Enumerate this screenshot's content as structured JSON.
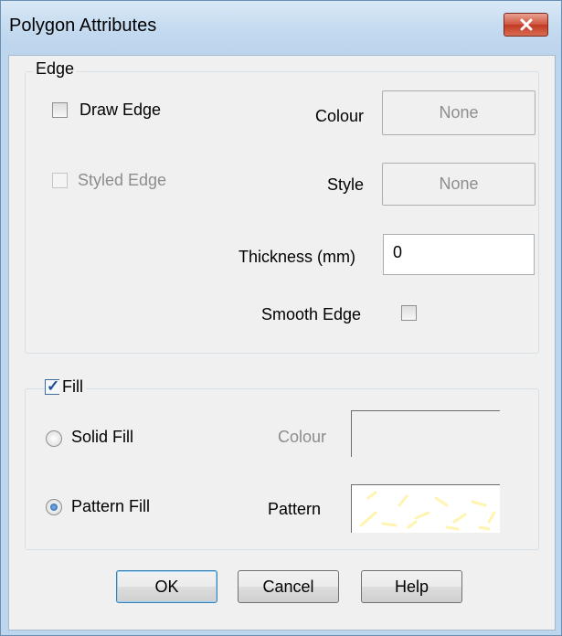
{
  "window": {
    "title": "Polygon Attributes"
  },
  "edge_group": {
    "legend": "Edge",
    "draw_edge": {
      "label": "Draw Edge",
      "checked": false
    },
    "styled_edge": {
      "label": "Styled Edge",
      "checked": false,
      "enabled": false
    },
    "colour": {
      "label": "Colour",
      "value": "None"
    },
    "style": {
      "label": "Style",
      "value": "None"
    },
    "thickness": {
      "label": "Thickness (mm)",
      "value": "0"
    },
    "smooth_edge": {
      "label": "Smooth Edge",
      "checked": false
    }
  },
  "fill_group": {
    "legend": "Fill",
    "checked": true,
    "solid_fill": {
      "label": "Solid Fill",
      "selected": false
    },
    "pattern_fill": {
      "label": "Pattern Fill",
      "selected": true
    },
    "colour_label": "Colour",
    "pattern_label": "Pattern",
    "pattern_color": "#fffbd0"
  },
  "buttons": {
    "ok": "OK",
    "cancel": "Cancel",
    "help": "Help"
  },
  "colors": {
    "titlebar": "#c2d9ef",
    "close": "#c23a22",
    "default_button_border": "#3c7fb1"
  },
  "icons": {
    "close": "close-icon",
    "check": "checkmark-icon"
  }
}
